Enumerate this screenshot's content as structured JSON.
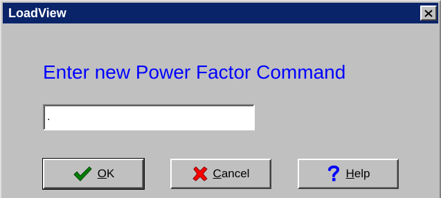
{
  "window": {
    "title": "LoadView"
  },
  "dialog": {
    "prompt": "Enter new Power Factor Command",
    "input_value": "."
  },
  "buttons": {
    "ok": {
      "accel": "O",
      "rest": "K",
      "icon": "checkmark-icon"
    },
    "cancel": {
      "accel": "C",
      "rest": "ancel",
      "icon": "x-icon"
    },
    "help": {
      "accel": "H",
      "rest": "elp",
      "icon": "question-icon"
    }
  },
  "colors": {
    "titlebar": "#0a246a",
    "prompt_text": "#0000ff",
    "dialog_bg": "#c0c0c0",
    "check": "#008000",
    "cross": "#ff0000",
    "question": "#0000ff"
  }
}
